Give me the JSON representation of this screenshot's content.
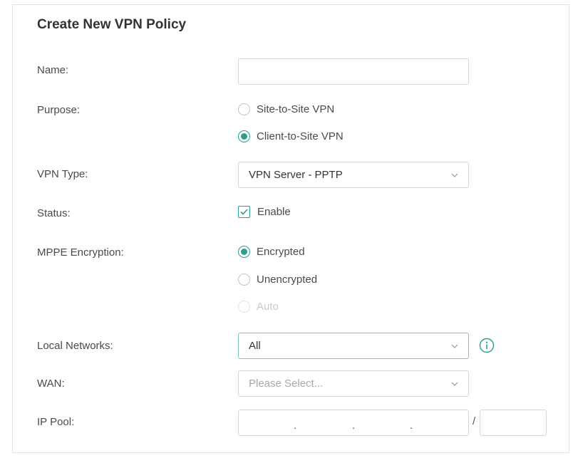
{
  "form": {
    "title": "Create New VPN Policy",
    "name": {
      "label": "Name:",
      "value": ""
    },
    "purpose": {
      "label": "Purpose:",
      "options": [
        {
          "label": "Site-to-Site VPN",
          "checked": false
        },
        {
          "label": "Client-to-Site VPN",
          "checked": true
        }
      ]
    },
    "vpn_type": {
      "label": "VPN Type:",
      "selected": "VPN Server - PPTP"
    },
    "status": {
      "label": "Status:",
      "checkbox_label": "Enable",
      "checked": true
    },
    "mppe": {
      "label": "MPPE Encryption:",
      "options": [
        {
          "label": "Encrypted",
          "checked": true,
          "disabled": false
        },
        {
          "label": "Unencrypted",
          "checked": false,
          "disabled": false
        },
        {
          "label": "Auto",
          "checked": false,
          "disabled": true
        }
      ]
    },
    "local_networks": {
      "label": "Local Networks:",
      "selected": "All"
    },
    "wan": {
      "label": "WAN:",
      "placeholder": "Please Select..."
    },
    "ip_pool": {
      "label": "IP Pool:",
      "octet_separator": ".",
      "mask_separator": "/",
      "mask_value": ""
    }
  },
  "colors": {
    "accent": "#2a9d8f",
    "border": "#d6d6d6",
    "label_text": "#4a4a4a"
  }
}
